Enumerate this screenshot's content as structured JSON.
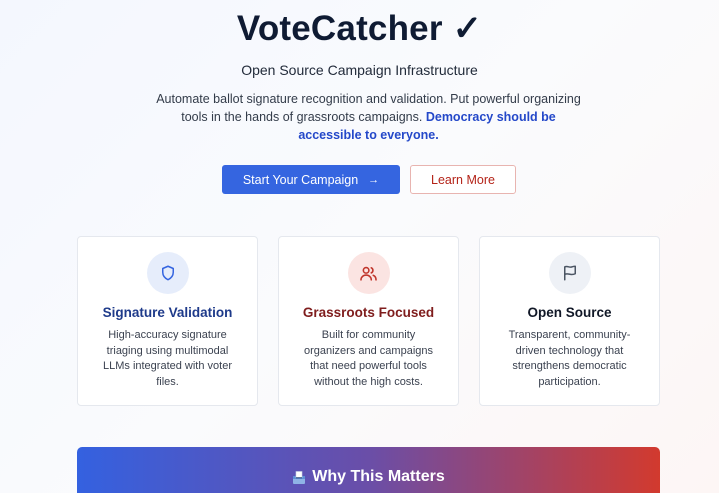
{
  "hero": {
    "title": "VoteCatcher ✓",
    "subtitle": "Open Source Campaign Infrastructure",
    "description": "Automate ballot signature recognition and validation. Put powerful organizing tools in the hands of grassroots campaigns.",
    "description_emphasis": "Democracy should be accessible to everyone."
  },
  "actions": {
    "primary_label": "Start Your Campaign",
    "primary_arrow": "→",
    "secondary_label": "Learn More"
  },
  "features": [
    {
      "title": "Signature Validation",
      "text": "High-accuracy signature triaging using multimodal LLMs integrated with voter files.",
      "icon": "shield-icon",
      "accent": "#1e3a8a",
      "icon_bg": "#e6edfb",
      "icon_color": "#3565e0"
    },
    {
      "title": "Grassroots Focused",
      "text": "Built for community organizers and campaigns that need powerful tools without the high costs.",
      "icon": "users-icon",
      "accent": "#7f1d1d",
      "icon_bg": "#fbe4e2",
      "icon_color": "#c0352b"
    },
    {
      "title": "Open Source",
      "text": "Transparent, community-driven technology that strengthens democratic participation.",
      "icon": "flag-icon",
      "accent": "#111827",
      "icon_bg": "#eef1f6",
      "icon_color": "#4b5563"
    }
  ],
  "banner": {
    "title": "Why This Matters",
    "icon": "ballot-box-icon"
  }
}
